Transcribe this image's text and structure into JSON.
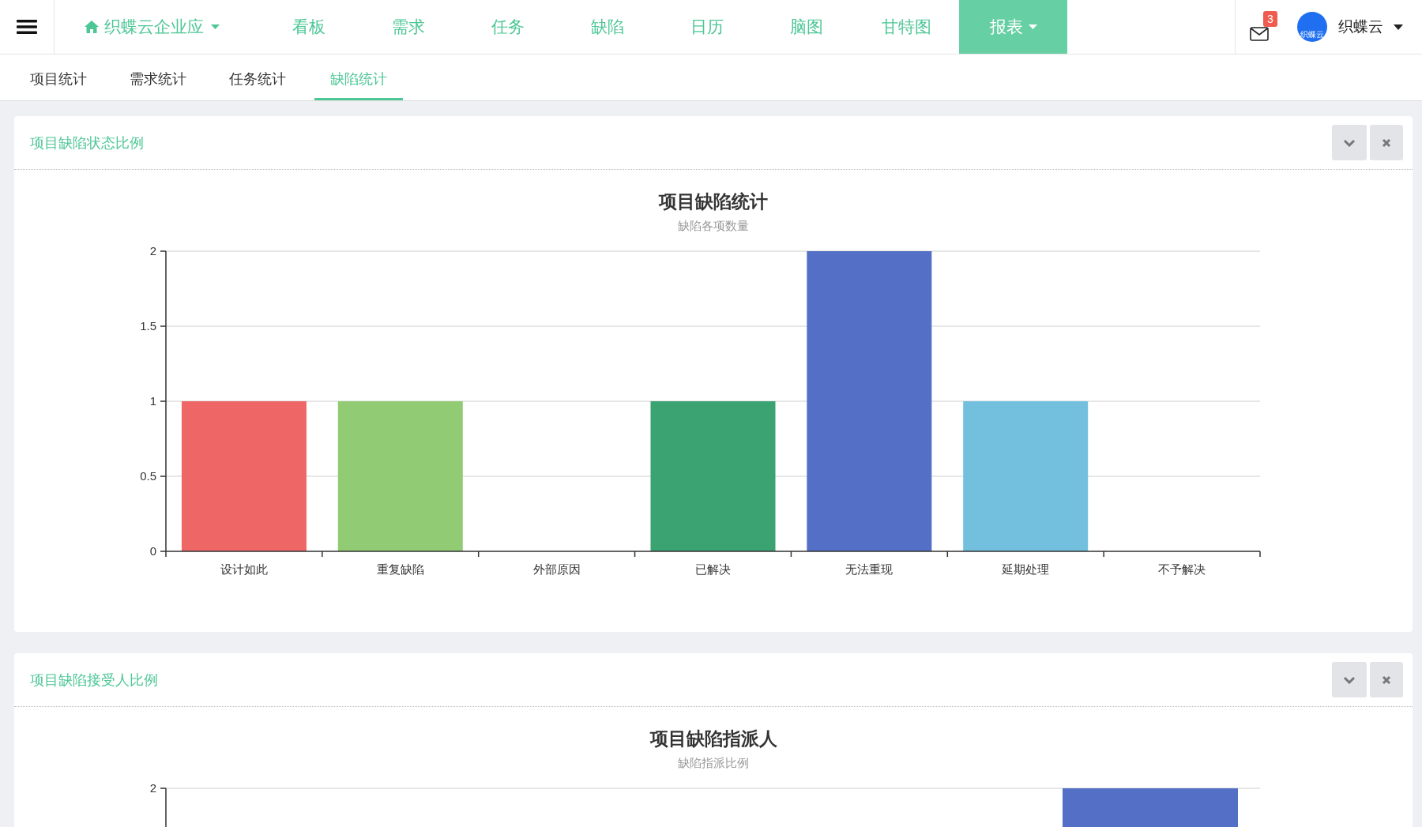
{
  "nav": {
    "brand": "织蝶云企业应",
    "items": [
      {
        "label": "看板",
        "selected": false,
        "dropdown": false
      },
      {
        "label": "需求",
        "selected": false,
        "dropdown": false
      },
      {
        "label": "任务",
        "selected": false,
        "dropdown": false
      },
      {
        "label": "缺陷",
        "selected": false,
        "dropdown": false
      },
      {
        "label": "日历",
        "selected": false,
        "dropdown": false
      },
      {
        "label": "脑图",
        "selected": false,
        "dropdown": false
      },
      {
        "label": "甘特图",
        "selected": false,
        "dropdown": false
      },
      {
        "label": "报表",
        "selected": true,
        "dropdown": true
      }
    ]
  },
  "messages": {
    "badge": "3"
  },
  "user": {
    "avatar_text": "织蝶云",
    "name": "织蝶云"
  },
  "subtabs": [
    {
      "label": "项目统计",
      "selected": false
    },
    {
      "label": "需求统计",
      "selected": false
    },
    {
      "label": "任务统计",
      "selected": false
    },
    {
      "label": "缺陷统计",
      "selected": true
    }
  ],
  "panels": [
    {
      "title": "项目缺陷状态比例",
      "chart_title": "项目缺陷统计",
      "chart_subtitle": "缺陷各项数量",
      "chart_data": {
        "type": "bar",
        "categories": [
          "设计如此",
          "重复缺陷",
          "外部原因",
          "已解决",
          "无法重现",
          "延期处理",
          "不予解决"
        ],
        "series": [
          {
            "values": [
              1,
              1,
              0,
              1,
              2,
              1,
              0
            ]
          }
        ],
        "grid": true,
        "ylim": [
          0,
          2
        ],
        "yticks": [
          0,
          {
            "value": 0.5,
            "label": "0.5"
          },
          1,
          {
            "value": 1.5,
            "label": "1.5"
          },
          2
        ]
      }
    },
    {
      "title": "项目缺陷接受人比例",
      "chart_title": "项目缺陷指派人",
      "chart_subtitle": "缺陷指派比例",
      "axis_tick": "2"
    }
  ]
}
